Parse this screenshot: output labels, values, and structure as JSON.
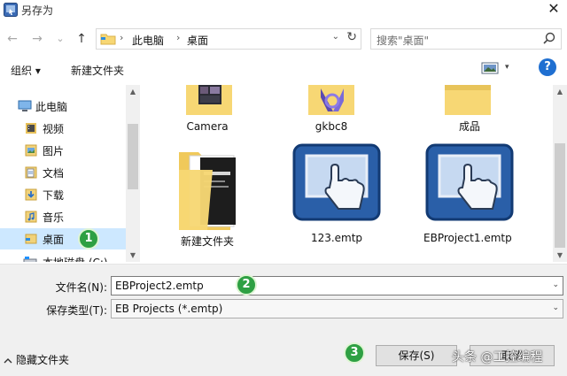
{
  "window": {
    "title": "另存为",
    "close_glyph": "✕"
  },
  "nav": {
    "back_glyph": "←",
    "forward_glyph": "→",
    "recent_glyph": "⌄",
    "up_glyph": "↑",
    "breadcrumb": [
      "此电脑",
      "桌面"
    ],
    "separator": "›",
    "dropdown_glyph": "⌄",
    "refresh_glyph": "↻",
    "search_placeholder": "搜索\"桌面\""
  },
  "toolbar": {
    "organize": "组织 ▾",
    "new_folder": "新建文件夹",
    "view_dropdown": "▾",
    "help": "?"
  },
  "sidebar": {
    "items": [
      {
        "label": "此电脑",
        "icon": "computer-icon"
      },
      {
        "label": "视频",
        "icon": "video-folder-icon"
      },
      {
        "label": "图片",
        "icon": "pictures-folder-icon"
      },
      {
        "label": "文档",
        "icon": "documents-folder-icon"
      },
      {
        "label": "下载",
        "icon": "downloads-folder-icon"
      },
      {
        "label": "音乐",
        "icon": "music-folder-icon"
      },
      {
        "label": "桌面",
        "icon": "desktop-folder-icon",
        "selected": true
      },
      {
        "label": "本地磁盘 (C:)",
        "icon": "drive-icon"
      }
    ],
    "scroll_up": "▲",
    "scroll_down": "▼"
  },
  "files": [
    {
      "name": "Camera",
      "type": "folder-photo"
    },
    {
      "name": "gkbc8",
      "type": "folder-vs"
    },
    {
      "name": "成品",
      "type": "folder"
    },
    {
      "name": "新建文件夹",
      "type": "folder-doc"
    },
    {
      "name": "123.emtp",
      "type": "emtp"
    },
    {
      "name": "EBProject1.emtp",
      "type": "emtp"
    }
  ],
  "form": {
    "filename_label": "文件名(N):",
    "filename_value": "EBProject2.emtp",
    "filetype_label": "保存类型(T):",
    "filetype_value": "EB Projects (*.emtp)",
    "dd_glyph": "⌄"
  },
  "footer": {
    "hide_folders": "隐藏文件夹",
    "save": "保存(S)",
    "cancel": "取消"
  },
  "markers": [
    "1",
    "2",
    "3"
  ],
  "watermark": "头条 @工控编程",
  "colors": {
    "selection": "#cde8ff",
    "folder": "#f7d774",
    "marker": "#2ea043",
    "emtp_blue": "#2a5fa8",
    "help": "#1f6fd1"
  }
}
